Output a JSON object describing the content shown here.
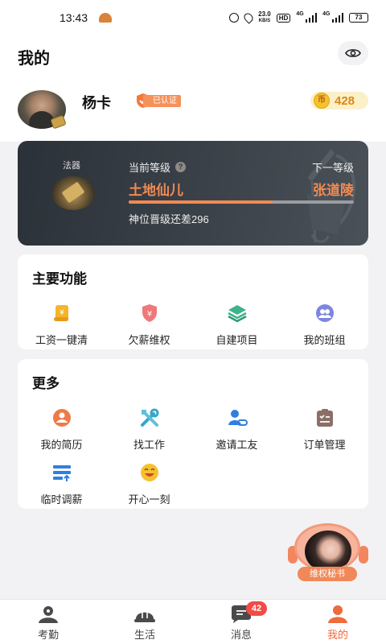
{
  "status_bar": {
    "time": "13:43",
    "net_speed_value": "23.0",
    "net_speed_unit": "KB/S",
    "hd_label": "HD",
    "net_type_1": "4G",
    "net_type_2": "4G",
    "battery": "73"
  },
  "header": {
    "title": "我的"
  },
  "user": {
    "name": "杨卡",
    "verified_label": "已认证",
    "coin_symbol": "币",
    "coin_count": "428"
  },
  "level_card": {
    "artifact_label": "法器",
    "current_label": "当前等级",
    "next_label": "下一等级",
    "current_level": "土地仙儿",
    "next_level": "张道陵",
    "progress_fraction": 0.64,
    "progress_text": "神位晋级还差296"
  },
  "main_functions": {
    "title": "主要功能",
    "items": [
      {
        "label": "工资一键清",
        "icon": "wage-scroll-icon"
      },
      {
        "label": "欠薪维权",
        "icon": "shield-yen-icon"
      },
      {
        "label": "自建项目",
        "icon": "layers-icon"
      },
      {
        "label": "我的班组",
        "icon": "team-icon"
      }
    ]
  },
  "more": {
    "title": "更多",
    "items": [
      {
        "label": "我的简历",
        "icon": "resume-icon"
      },
      {
        "label": "找工作",
        "icon": "tools-icon"
      },
      {
        "label": "邀请工友",
        "icon": "invite-user-icon"
      },
      {
        "label": "订单管理",
        "icon": "clipboard-icon"
      },
      {
        "label": "临时调薪",
        "icon": "salary-adjust-icon"
      },
      {
        "label": "开心一刻",
        "icon": "smile-icon"
      }
    ]
  },
  "assistant": {
    "label": "维权秘书"
  },
  "tab_bar": {
    "tabs": [
      {
        "label": "考勤",
        "icon": "attendance-icon"
      },
      {
        "label": "生活",
        "icon": "helmet-icon"
      },
      {
        "label": "消息",
        "icon": "message-icon",
        "badge": "42"
      },
      {
        "label": "我的",
        "icon": "profile-icon"
      }
    ],
    "active_index": 3
  },
  "colors": {
    "accent": "#ef6a3c",
    "level_card_bg": "#2b3138",
    "badge_red": "#f24b45"
  }
}
